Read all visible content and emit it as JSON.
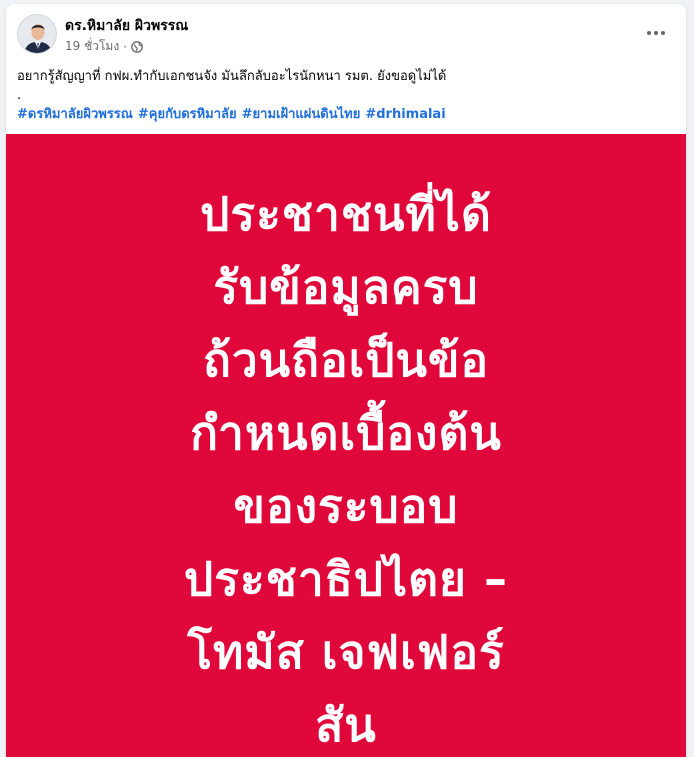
{
  "post": {
    "author_name": "ดร.หิมาลัย ผิวพรรณ",
    "timestamp": "19 ชั่วโมง",
    "separator": "·",
    "audience_icon": "globe-icon",
    "more_icon": "more-options-icon",
    "text_line": "อยากรู้สัญญาที่ กฟผ.ทำกับเอกชนจัง มันลึกลับอะไรนักหนา รมต. ยังขอดูไม่ได้",
    "dot_line": ".",
    "hashtags": [
      "#ดรหิมาลัยผิวพรรณ",
      "#คุยกับดรหิมาลัย",
      "#ยามเฝ้าแผ่นดินไทย",
      "#drhimalai"
    ]
  },
  "image": {
    "background_color": "#e0083b",
    "text_color": "#ffffff",
    "quote_lines": [
      "ประชาชนที่ได้",
      "รับข้อมูลครบ",
      "ถ้วนถือเป็นข้อ",
      "กำหนดเบื้องต้น",
      "ของระบอบ",
      "ประชาธิปไตย –",
      "โทมัส เจฟเฟอร์",
      "สัน"
    ]
  }
}
